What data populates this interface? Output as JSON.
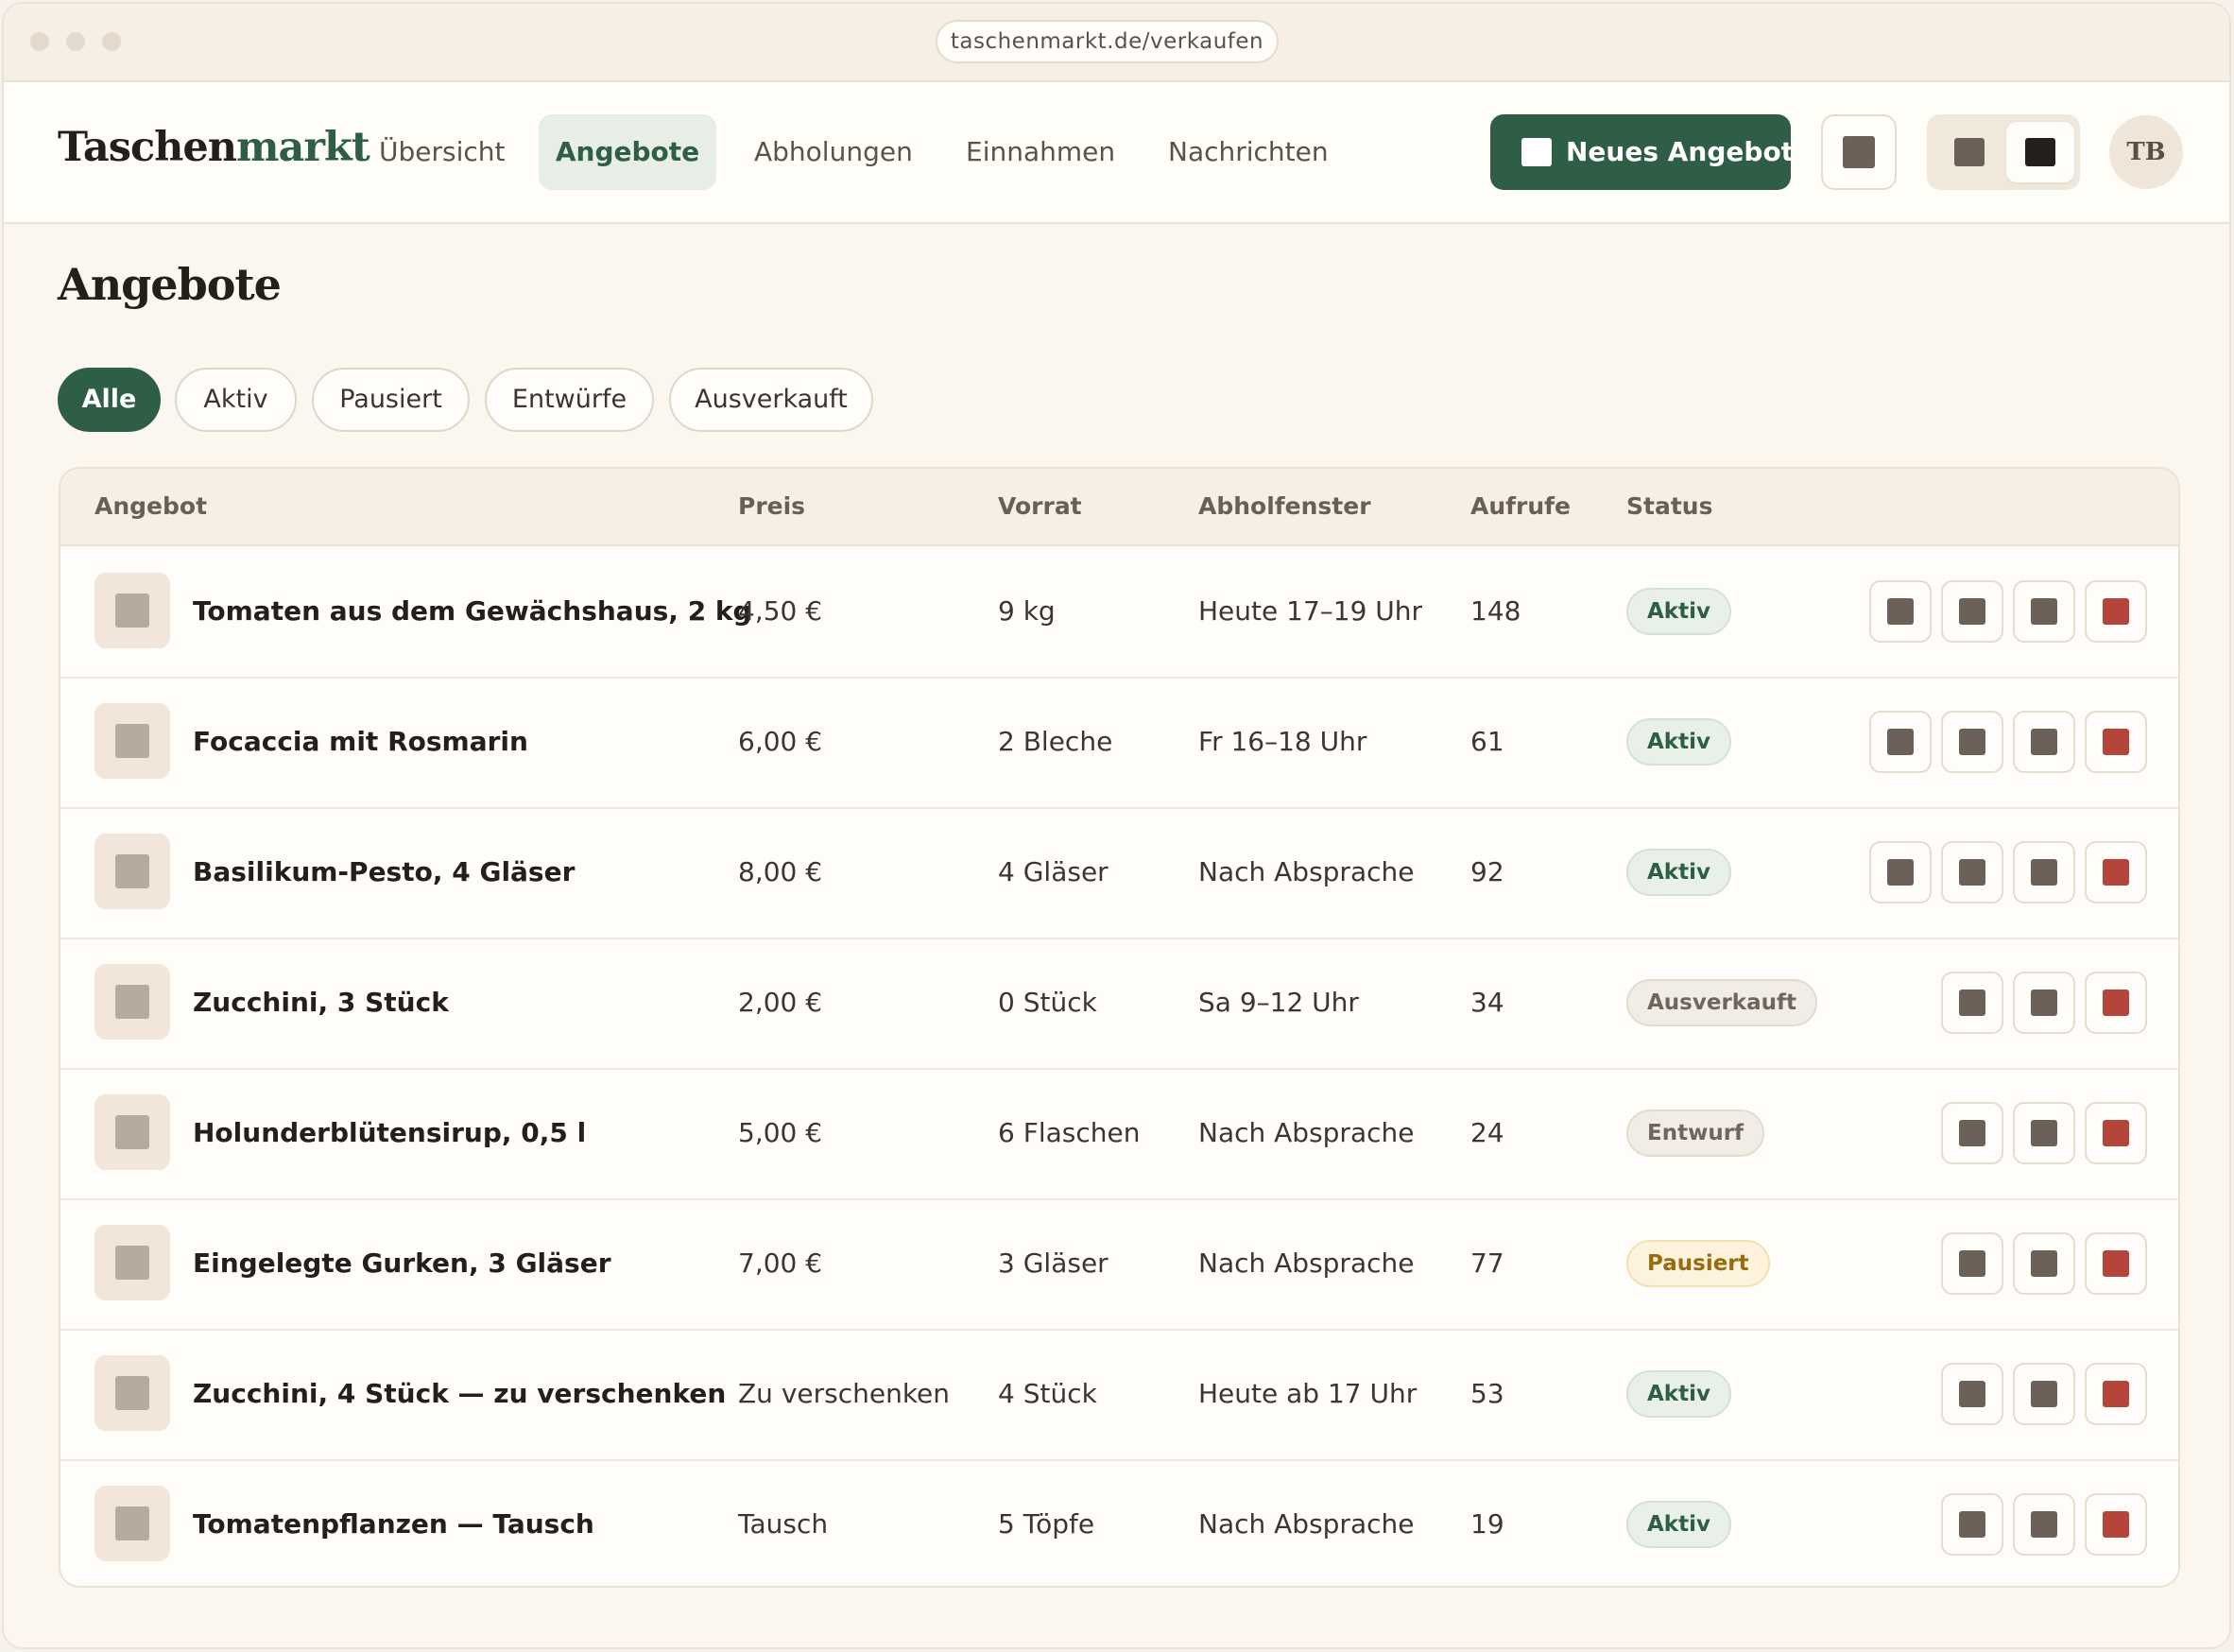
{
  "browser": {
    "url": "taschenmarkt.de/verkaufen"
  },
  "header": {
    "logo_part1": "Taschen",
    "logo_part2": "markt",
    "nav": [
      "Übersicht",
      "Angebote",
      "Abholungen",
      "Einnahmen",
      "Nachrichten"
    ],
    "active_nav": "Angebote",
    "new_button": "Neues Angebot",
    "avatar_initials": "TB"
  },
  "page": {
    "title": "Angebote",
    "filters": [
      "Alle",
      "Aktiv",
      "Pausiert",
      "Entwürfe",
      "Ausverkauft"
    ],
    "active_filter": "Alle"
  },
  "table": {
    "columns": [
      "Angebot",
      "Preis",
      "Vorrat",
      "Abholfenster",
      "Aufrufe",
      "Status"
    ],
    "rows": [
      {
        "name": "Tomaten aus dem Gewächshaus, 2 kg",
        "preis": "4,50 €",
        "vorrat": "9 kg",
        "abholfenster": "Heute 17–19 Uhr",
        "aufrufe": "148",
        "status": "Aktiv"
      },
      {
        "name": "Focaccia mit Rosmarin",
        "preis": "6,00 €",
        "vorrat": "2 Bleche",
        "abholfenster": "Fr 16–18 Uhr",
        "aufrufe": "61",
        "status": "Aktiv"
      },
      {
        "name": "Basilikum-Pesto, 4 Gläser",
        "preis": "8,00 €",
        "vorrat": "4 Gläser",
        "abholfenster": "Nach Absprache",
        "aufrufe": "92",
        "status": "Aktiv"
      },
      {
        "name": "Zucchini, 3 Stück",
        "preis": "2,00 €",
        "vorrat": "0 Stück",
        "abholfenster": "Sa 9–12 Uhr",
        "aufrufe": "34",
        "status": "Ausverkauft"
      },
      {
        "name": "Holunderblütensirup, 0,5 l",
        "preis": "5,00 €",
        "vorrat": "6 Flaschen",
        "abholfenster": "Nach Absprache",
        "aufrufe": "24",
        "status": "Entwurf"
      },
      {
        "name": "Eingelegte Gurken, 3 Gläser",
        "preis": "7,00 €",
        "vorrat": "3 Gläser",
        "abholfenster": "Nach Absprache",
        "aufrufe": "77",
        "status": "Pausiert"
      },
      {
        "name": "Zucchini, 4 Stück — zu verschenken",
        "preis": "Zu verschenken",
        "vorrat": "4 Stück",
        "abholfenster": "Heute ab 17 Uhr",
        "aufrufe": "53",
        "status": "Aktiv"
      },
      {
        "name": "Tomatenpflanzen — Tausch",
        "preis": "Tausch",
        "vorrat": "5 Töpfe",
        "abholfenster": "Nach Absprache",
        "aufrufe": "19",
        "status": "Aktiv"
      }
    ]
  },
  "colors": {
    "brand_green": "#2e5e45",
    "danger_red": "#b5443a",
    "icon_gray": "#6b6158"
  }
}
